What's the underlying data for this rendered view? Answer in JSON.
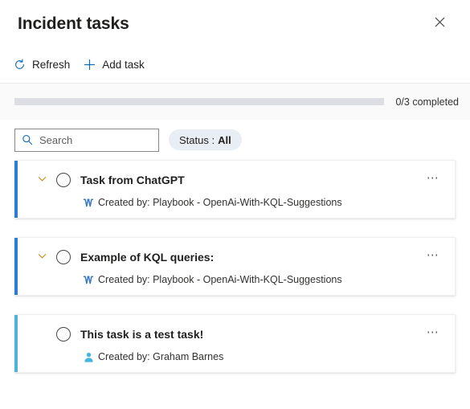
{
  "panel": {
    "title": "Incident tasks",
    "close_label": "Close",
    "close_icon": "close-icon"
  },
  "command_bar": {
    "items": [
      {
        "label": "Refresh",
        "icon": "refresh-icon"
      },
      {
        "label": "Add task",
        "icon": "add-icon"
      }
    ]
  },
  "progress": {
    "completed": 0,
    "total": 3,
    "percent": 0,
    "label": "0/3 completed",
    "track_color": "#dcdee4",
    "fill_color": "#0f6cbd"
  },
  "filters": {
    "search": {
      "placeholder": "Search",
      "value": "",
      "icon": "search-icon"
    },
    "status_filter": {
      "prefix": "Status : ",
      "value": "All",
      "icon": "filter-pill"
    }
  },
  "tasks": [
    {
      "title": "Task from ChatGPT",
      "created_by": "Created by: Playbook - OpenAi-With-KQL-Suggestions",
      "source_icon": "playbook-icon",
      "accent_color": "#2b7cd3",
      "has_chevron": true,
      "checked": false,
      "more_label": "⋯"
    },
    {
      "title": "Example of KQL queries:",
      "created_by": "Created by: Playbook - OpenAi-With-KQL-Suggestions",
      "source_icon": "playbook-icon",
      "accent_color": "#2b7cd3",
      "has_chevron": true,
      "checked": false,
      "more_label": "⋯"
    },
    {
      "title": "This task is a test task!",
      "created_by": "Created by: Graham Barnes",
      "source_icon": "person-icon",
      "accent_color": "#4fb3d9",
      "has_chevron": false,
      "checked": false,
      "more_label": "⋯"
    }
  ],
  "colors": {
    "accent_blue": "#0f6cbd",
    "accent_cyan": "#4fb3d9",
    "chevron_orange": "#d4820a",
    "band_background": "#fafafa"
  }
}
